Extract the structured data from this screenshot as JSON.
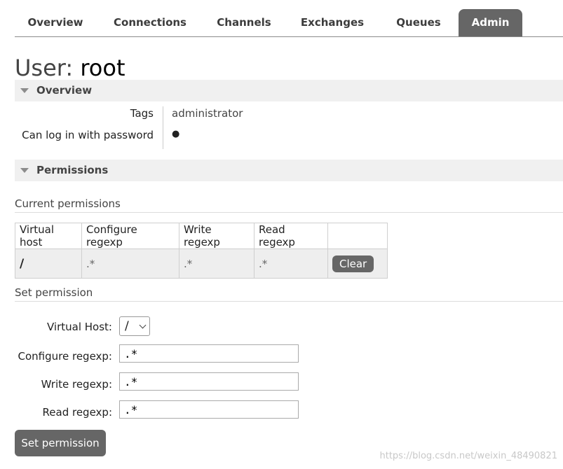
{
  "nav": {
    "tabs": [
      {
        "label": "Overview"
      },
      {
        "label": "Connections"
      },
      {
        "label": "Channels"
      },
      {
        "label": "Exchanges"
      },
      {
        "label": "Queues"
      },
      {
        "label": "Admin",
        "active": true
      }
    ]
  },
  "page": {
    "title_prefix": "User:",
    "title_name": "root"
  },
  "overview": {
    "heading": "Overview",
    "tags_label": "Tags",
    "tags_value": "administrator",
    "login_label": "Can log in with password",
    "login_value": "●"
  },
  "permissions": {
    "heading": "Permissions",
    "current_heading": "Current permissions",
    "table": {
      "headers": [
        "Virtual host",
        "Configure regexp",
        "Write regexp",
        "Read regexp",
        ""
      ],
      "rows": [
        {
          "vhost": "/",
          "configure": ".*",
          "write": ".*",
          "read": ".*",
          "action": "Clear"
        }
      ]
    },
    "set_heading": "Set permission",
    "form": {
      "vhost_label": "Virtual Host:",
      "vhost_value": "/",
      "configure_label": "Configure regexp:",
      "configure_value": ".*",
      "write_label": "Write regexp:",
      "write_value": ".*",
      "read_label": "Read regexp:",
      "read_value": ".*",
      "submit": "Set permission"
    }
  },
  "watermark": "https://blog.csdn.net/weixin_48490821",
  "colors": {
    "tab_active_bg": "#666666",
    "section_bg": "#f0f0f0",
    "button_bg": "#666666"
  }
}
